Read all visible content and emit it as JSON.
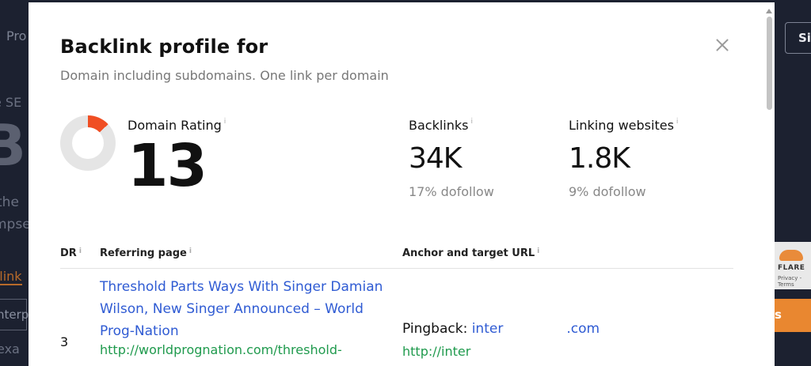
{
  "background": {
    "nav_fragment": "Pro",
    "seo_fragment": "e SE",
    "headline_fragment": "Ba",
    "line1_fragment": "the",
    "line2_fragment": "mpse",
    "link_fragment": "klink",
    "input_fragment": "nterp",
    "example_fragment": "exa",
    "signin_fragment": "Si",
    "cloudflare_label": "FLARE",
    "cloudflare_terms": "Privacy - Terms",
    "orange_button_fragment": "s"
  },
  "modal": {
    "title": "Backlink profile for",
    "subtitle": "Domain including subdomains. One link per domain",
    "close_label": "Close"
  },
  "metrics": {
    "domain_rating": {
      "label": "Domain Rating",
      "value": "13",
      "fraction": 0.13,
      "color": "#f04e23"
    },
    "backlinks": {
      "label": "Backlinks",
      "value": "34K",
      "sub": "17% dofollow"
    },
    "linking_websites": {
      "label": "Linking websites",
      "value": "1.8K",
      "sub": "9% dofollow"
    }
  },
  "table": {
    "columns": [
      "DR",
      "Referring page",
      "Anchor and target URL"
    ],
    "rows": [
      {
        "dr": "3",
        "title": "Threshold Parts Ways With Singer Damian Wilson, New Singer Announced – World Prog-Nation",
        "url": "http://worldprognation.com/threshold-",
        "anchor_prefix": "Pingback:",
        "anchor_link_start": "inter",
        "anchor_link_end": ".com",
        "target_url": "http://inter"
      }
    ]
  }
}
